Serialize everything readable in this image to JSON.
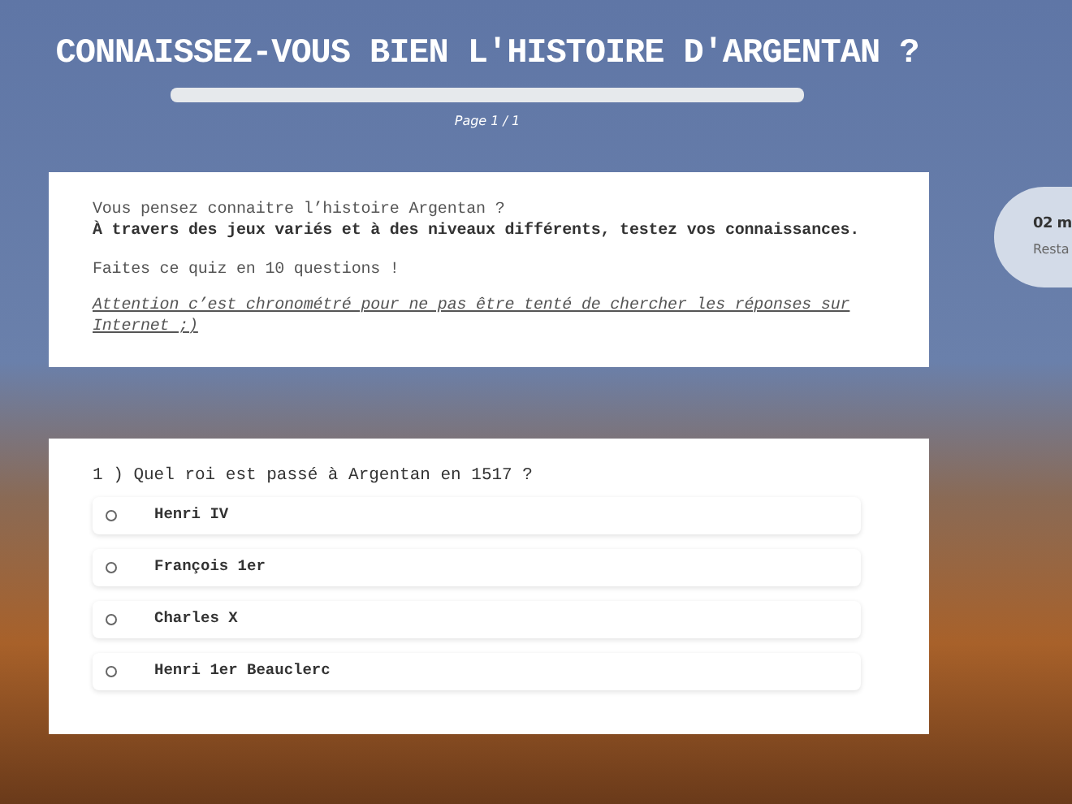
{
  "title": "CONNAISSEZ-VOUS BIEN L'HISTOIRE D'ARGENTAN ?",
  "progress": {
    "level": 0
  },
  "page_indicator": "Page 1 / 1",
  "intro": {
    "lines": [
      "Vous pensez connaitre l’histoire Argentan ?",
      "À travers des jeux variés et à des niveaux différents, testez vos connaissances."
    ],
    "count_line": "Faites ce quiz en 10 questions !",
    "warning": "Attention c’est chronométré pour ne pas être tenté de chercher les réponses sur Internet ;) "
  },
  "timer": {
    "time": "02 m",
    "label": "Resta"
  },
  "question": {
    "text": "1 ) Quel roi est passé à Argentan en 1517 ?",
    "options": [
      {
        "label": "Henri IV",
        "selected": false
      },
      {
        "label": "François 1er",
        "selected": false
      },
      {
        "label": "Charles X",
        "selected": false
      },
      {
        "label": "Henri 1er Beauclerc",
        "selected": false
      }
    ]
  }
}
